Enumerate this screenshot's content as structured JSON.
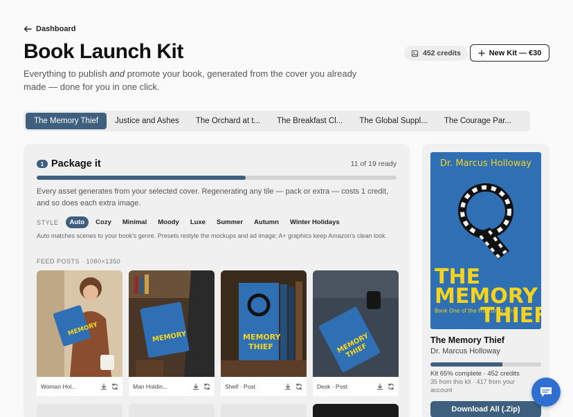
{
  "nav": {
    "back_label": "Dashboard"
  },
  "header": {
    "title": "Book Launch Kit",
    "subtitle_before": "Everything to publish ",
    "subtitle_em": "and",
    "subtitle_after": " promote your book, generated from the cover you already made — done for you in one click.",
    "credits": "452 credits",
    "new_kit_label": "New Kit — €30"
  },
  "tabs": [
    {
      "label": "The Memory Thief",
      "active": true
    },
    {
      "label": "Justice and Ashes",
      "active": false
    },
    {
      "label": "The Orchard at t...",
      "active": false
    },
    {
      "label": "The Breakfast Cl...",
      "active": false
    },
    {
      "label": "The Global Suppl...",
      "active": false
    },
    {
      "label": "The Courage Par...",
      "active": false
    }
  ],
  "package": {
    "step_number": "1",
    "title": "Package it",
    "ready_text": "11 of 19 ready",
    "progress": 0.58,
    "description": "Every asset generates from your selected cover. Regenerating any tile — pack or extra — costs 1 credit, and so does each extra image.",
    "style_label": "STYLE",
    "styles": [
      {
        "label": "Auto",
        "active": true
      },
      {
        "label": "Cozy",
        "active": false
      },
      {
        "label": "Minimal",
        "active": false
      },
      {
        "label": "Moody",
        "active": false
      },
      {
        "label": "Luxe",
        "active": false
      },
      {
        "label": "Summer",
        "active": false
      },
      {
        "label": "Autumn",
        "active": false
      },
      {
        "label": "Winter Holidays",
        "active": false
      }
    ],
    "style_note": "Auto matches scenes to your book's genre. Presets restyle the mockups and ad image; A+ graphics keep Amazon's clean look.",
    "feed_label": "FEED POSTS · 1080×1350",
    "tiles": [
      {
        "name": "Woman Hol..."
      },
      {
        "name": "Man Holdin..."
      },
      {
        "name": "Shelf · Post"
      },
      {
        "name": "Desk · Post"
      }
    ]
  },
  "sidebar": {
    "cover_author": "Dr. Marcus Holloway",
    "cover_title_line1": "THE",
    "cover_title_line2": "MEMORY",
    "cover_title_line3": "THIEF",
    "cover_series": "Book One of the Fractured Mind",
    "book_title": "The Memory Thief",
    "author": "Dr. Marcus Holloway",
    "progress": 0.65,
    "stat": "Kit 65% complete · 452 credits",
    "sub": "35 from this kit · 417 from your account",
    "download_label": "Download All (.Zip)"
  },
  "colors": {
    "accent": "#3f5f7f",
    "cover_blue": "#2f6fb4",
    "cover_yellow": "#f5d31e",
    "chat": "#2f6fd1"
  }
}
